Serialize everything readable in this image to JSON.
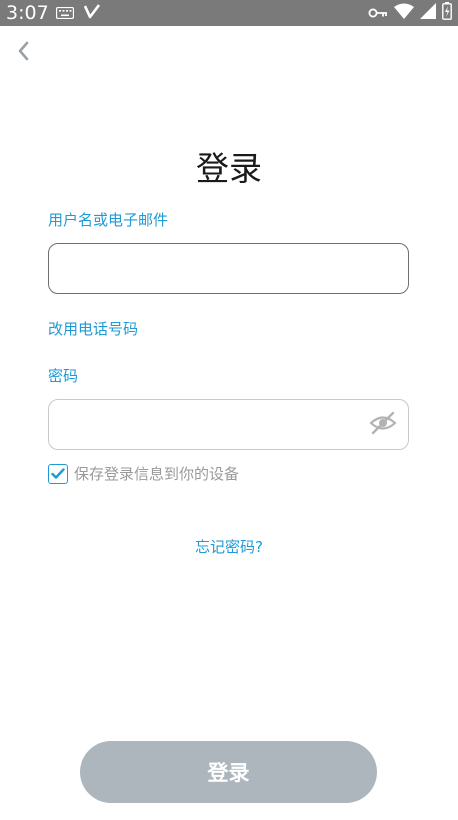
{
  "status_bar": {
    "time": "3:07",
    "icons": [
      "keyboard-icon",
      "v-app-icon",
      "vpn-key-icon",
      "wifi-icon",
      "signal-icon",
      "battery-icon"
    ]
  },
  "nav": {
    "back_icon": "chevron-left-icon"
  },
  "title": "登录",
  "form": {
    "username_label": "用户名或电子邮件",
    "username_value": "",
    "phone_link": "改用电话号码",
    "password_label": "密码",
    "password_value": "",
    "eye_icon": "eye-off-icon",
    "remember_checked": true,
    "remember_label": "保存登录信息到你的设备",
    "forgot_link": "忘记密码?"
  },
  "login_button_label": "登录",
  "colors": {
    "accent": "#1e9ad6",
    "status_bar": "#7a7a7a",
    "button_disabled": "#adb5bd",
    "muted_text": "#9a9a9a"
  }
}
